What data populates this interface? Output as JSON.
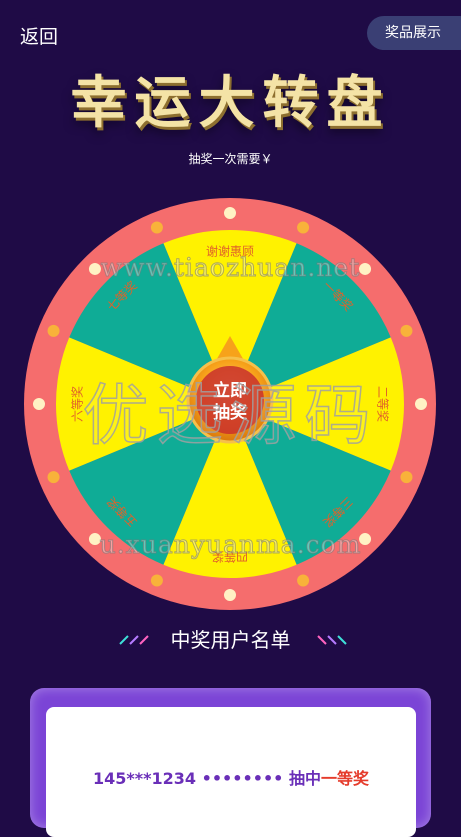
{
  "nav": {
    "back_label": "返回",
    "prize_button_label": "奖品展示"
  },
  "header": {
    "title": "幸运大转盘",
    "cost_text": "抽奖一次需要￥"
  },
  "wheel": {
    "button_label_line1": "立即",
    "button_label_line2": "抽奖",
    "sectors": [
      {
        "label": "谢谢惠顾",
        "color": "#fff200"
      },
      {
        "label": "一等奖",
        "color": "#0fac96"
      },
      {
        "label": "二等奖",
        "color": "#fff200"
      },
      {
        "label": "三等奖",
        "color": "#0fac96"
      },
      {
        "label": "四等奖",
        "color": "#fff200"
      },
      {
        "label": "五等奖",
        "color": "#0fac96"
      },
      {
        "label": "六等奖",
        "color": "#fff200"
      },
      {
        "label": "七等奖",
        "color": "#0fac96"
      }
    ],
    "rim_color": "#f56d6d"
  },
  "watermarks": {
    "url_top": "www.tiaozhuan.net",
    "big_text": "优选源码",
    "url_bottom": "u.xuanyuanma.com"
  },
  "winners": {
    "heading": "中奖用户名单",
    "entries": [
      {
        "phone": "145***1234",
        "dots": "••••••••",
        "action": "抽中",
        "prize": "一等奖"
      }
    ]
  }
}
